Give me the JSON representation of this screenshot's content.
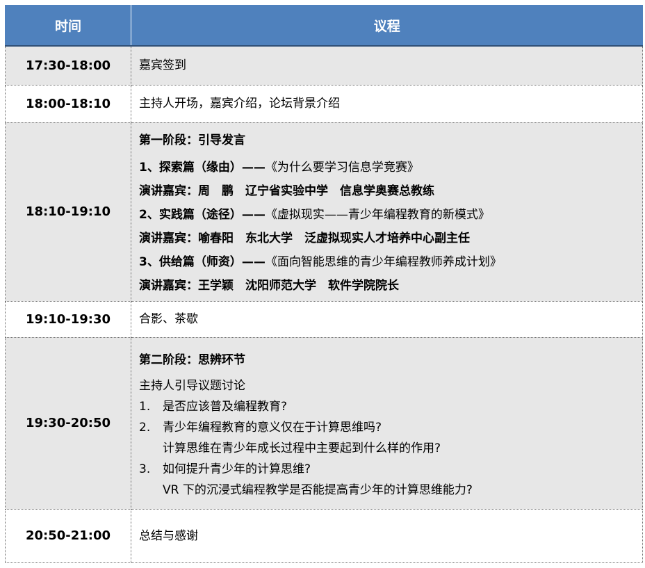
{
  "header": {
    "time": "时间",
    "agenda": "议程"
  },
  "rows": [
    {
      "time": "17:30-18:00",
      "lines": [
        "嘉宾签到"
      ]
    },
    {
      "time": "18:00-18:10",
      "lines": [
        "主持人开场，嘉宾介绍，论坛背景介绍"
      ]
    },
    {
      "time": "18:10-19:10",
      "stage": "第一阶段：引导发言",
      "items": [
        {
          "title": "1、探索篇（缘由）——",
          "topic": "《为什么要学习信息学竞赛》",
          "speaker": "演讲嘉宾：周　鹏　辽宁省实验中学　信息学奥赛总教练"
        },
        {
          "title": "2、实践篇（途径）——",
          "topic": "《虚拟现实——青少年编程教育的新模式》",
          "speaker": "演讲嘉宾：喻春阳　东北大学　泛虚拟现实人才培养中心副主任"
        },
        {
          "title": "3、供给篇（师资）——",
          "topic": "《面向智能思维的青少年编程教师养成计划》",
          "speaker": "演讲嘉宾：王学颖　沈阳师范大学　软件学院院长"
        }
      ]
    },
    {
      "time": "19:10-19:30",
      "lines": [
        "合影、茶歇"
      ]
    },
    {
      "time": "19:30-20:50",
      "stage": "第二阶段：思辨环节",
      "intro": "主持人引导议题讨论",
      "questions": [
        {
          "num": "1.",
          "text": "是否应该普及编程教育?"
        },
        {
          "num": "2.",
          "text": "青少年编程教育的意义仅在于计算思维吗?",
          "sub": "计算思维在青少年成长过程中主要起到什么样的作用?"
        },
        {
          "num": "3.",
          "text": "如何提升青少年的计算思维?",
          "sub": "VR 下的沉浸式编程教学是否能提高青少年的计算思维能力?"
        }
      ]
    },
    {
      "time": "20:50-21:00",
      "lines": [
        "总结与感谢"
      ]
    }
  ],
  "colors": {
    "header_bg": "#4f81bd",
    "shaded_row": "#e7e7e7",
    "header_text": "#ffffff"
  }
}
